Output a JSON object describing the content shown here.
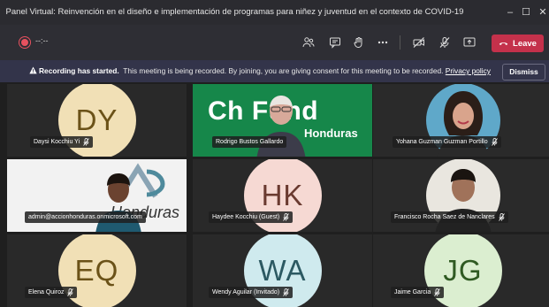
{
  "window": {
    "title": "Panel Virtual: Reinvención en el diseño e implementación de programas para niñez y juventud en el contexto de COVID-19",
    "minimize_glyph": "–",
    "maximize_glyph": "☐",
    "close_glyph": "✕"
  },
  "toolbar": {
    "timer": "--:--",
    "leave_label": "Leave"
  },
  "banner": {
    "bold_text": "Recording has started.",
    "message": "This meeting is being recorded. By joining, you are giving consent for this meeting to be recorded.",
    "link_text": "Privacy policy",
    "dismiss_label": "Dismiss"
  },
  "participants": [
    {
      "name": "Daysi Kocchiu Yi",
      "initials": "DY",
      "type": "avatar"
    },
    {
      "name": "Rodrigo Bustos Gallardo",
      "type": "video",
      "logo_text": "Ch  Fund",
      "logo_sub": "Honduras"
    },
    {
      "name": "Yohana Guzman Guzman Portillo",
      "type": "video"
    },
    {
      "name": "admin@accionhonduras.onmicrosoft.com",
      "type": "video",
      "logo_text": "Honduras"
    },
    {
      "name": "Haydee Kocchiu (Guest)",
      "initials": "HK",
      "type": "avatar"
    },
    {
      "name": "Francisco Rocha Saez de Nanclares",
      "type": "video"
    },
    {
      "name": "Elena Quiroz",
      "initials": "EQ",
      "type": "avatar"
    },
    {
      "name": "Wendy Aguilar (Invitado)",
      "initials": "WA",
      "type": "avatar"
    },
    {
      "name": "Jaime Garcia",
      "initials": "JG",
      "type": "avatar"
    }
  ]
}
